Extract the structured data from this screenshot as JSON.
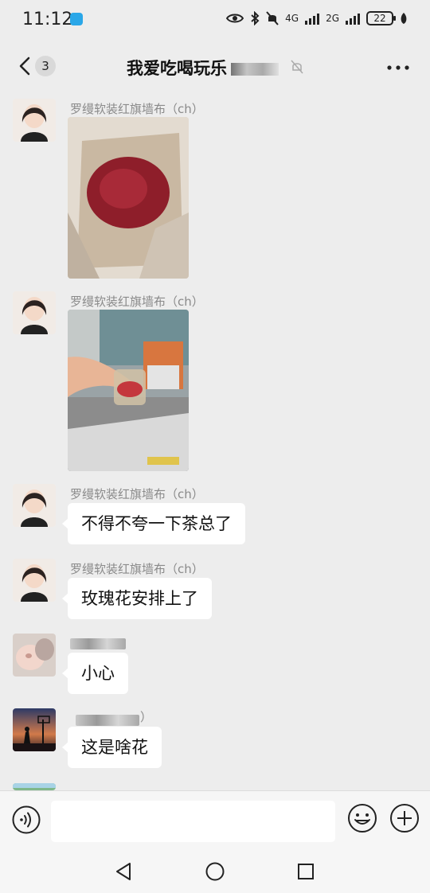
{
  "status_bar": {
    "time": "11:12",
    "network_a": "4G",
    "network_b": "2G",
    "battery": "22"
  },
  "header": {
    "title": "我爱吃喝玩乐",
    "unread_count": "3",
    "back_icon": "chevron-left-icon",
    "more_icon": "more-horizontal-icon",
    "mute_icon": "bell-off-icon"
  },
  "messages": [
    {
      "sender": "罗缦软装红旗墙布（ch）",
      "type": "image",
      "image_desc": "rose-tea-in-bag"
    },
    {
      "sender": "罗缦软装红旗墙布（ch）",
      "type": "image",
      "image_desc": "tea-cup-in-street"
    },
    {
      "sender": "罗缦软装红旗墙布（ch）",
      "type": "text",
      "text": "不得不夸一下茶总了"
    },
    {
      "sender": "罗缦软装红旗墙布（ch）",
      "type": "text",
      "text": "玫瑰花安排上了"
    },
    {
      "sender": "",
      "type": "text",
      "text": "小心"
    },
    {
      "sender": "）",
      "type": "text",
      "text": "这是啥花"
    }
  ],
  "input_bar": {
    "placeholder": "",
    "voice_icon": "voice-icon",
    "emoji_icon": "emoji-icon",
    "plus_icon": "plus-icon"
  },
  "colors": {
    "background": "#ededed",
    "bubble": "#ffffff",
    "sender_text": "#8a8a8a"
  }
}
